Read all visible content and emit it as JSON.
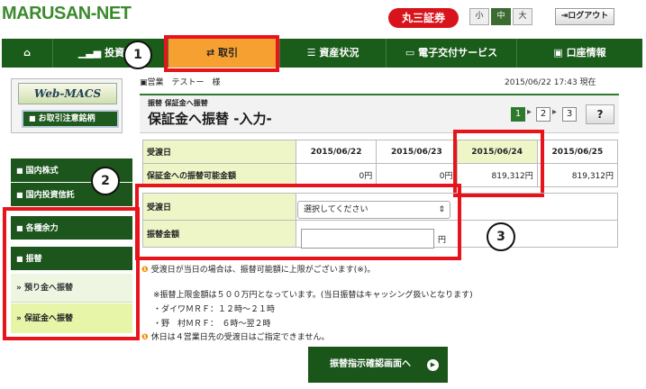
{
  "header": {
    "logo": "MARUSAN-NET",
    "brand": "丸三証券",
    "font_sizes": [
      "小",
      "中",
      "大"
    ],
    "logout": "ログアウト"
  },
  "nav": {
    "items": [
      "投資",
      "取引",
      "資産状況",
      "電子交付サービス",
      "口座情報"
    ],
    "active": "取引"
  },
  "callouts": [
    "1",
    "2",
    "3"
  ],
  "sidebar": {
    "logo": "Web-MACS",
    "caution_button": "お取引注意銘柄",
    "items": [
      {
        "label": "国内株式",
        "style": "dark"
      },
      {
        "label": "国内投資信託",
        "style": "dark"
      },
      {
        "label": "各種余力",
        "style": "dark"
      },
      {
        "label": "振替",
        "style": "dark"
      },
      {
        "label": "預り金へ振替",
        "style": "light"
      },
      {
        "label": "保証金へ振替",
        "style": "selected"
      }
    ]
  },
  "user_line": "営業　テストー　様",
  "timestamp": "2015/06/22 17:43 現在",
  "page": {
    "breadcrumb": "振替 保証金へ振替",
    "title": "保証金へ振替 -入力-",
    "steps": [
      "1",
      "2",
      "3"
    ],
    "current_step": 1,
    "help": "?"
  },
  "availability": {
    "row_header_date": "受渡日",
    "row_header_amount": "保証金への振替可能金額",
    "dates": [
      "2015/06/22",
      "2015/06/23",
      "2015/06/24",
      "2015/06/25"
    ],
    "amounts": [
      "0円",
      "0円",
      "819,312円",
      "819,312円"
    ]
  },
  "form": {
    "date_label": "受渡日",
    "date_select": "選択してください",
    "amount_label": "振替金額",
    "amount_value": "",
    "unit": "円"
  },
  "notes": {
    "line1": "受渡日が当日の場合は、振替可能額に上限がございます(※)。",
    "line2": "※振替上限金額は５００万円となっています。(当日振替はキャッシング扱いとなります)",
    "line3": "・ダイワＭＲＦ：１２時～２１時",
    "line4": "・野　村ＭＲＦ：　６時～翌２時",
    "line5": "休日は４営業日先の受渡日はご指定できません。"
  },
  "submit": "振替指示確認画面へ",
  "colors": {
    "accent": "#1a5c1a",
    "highlight": "#e8141c",
    "active_tab": "#f5a030"
  }
}
